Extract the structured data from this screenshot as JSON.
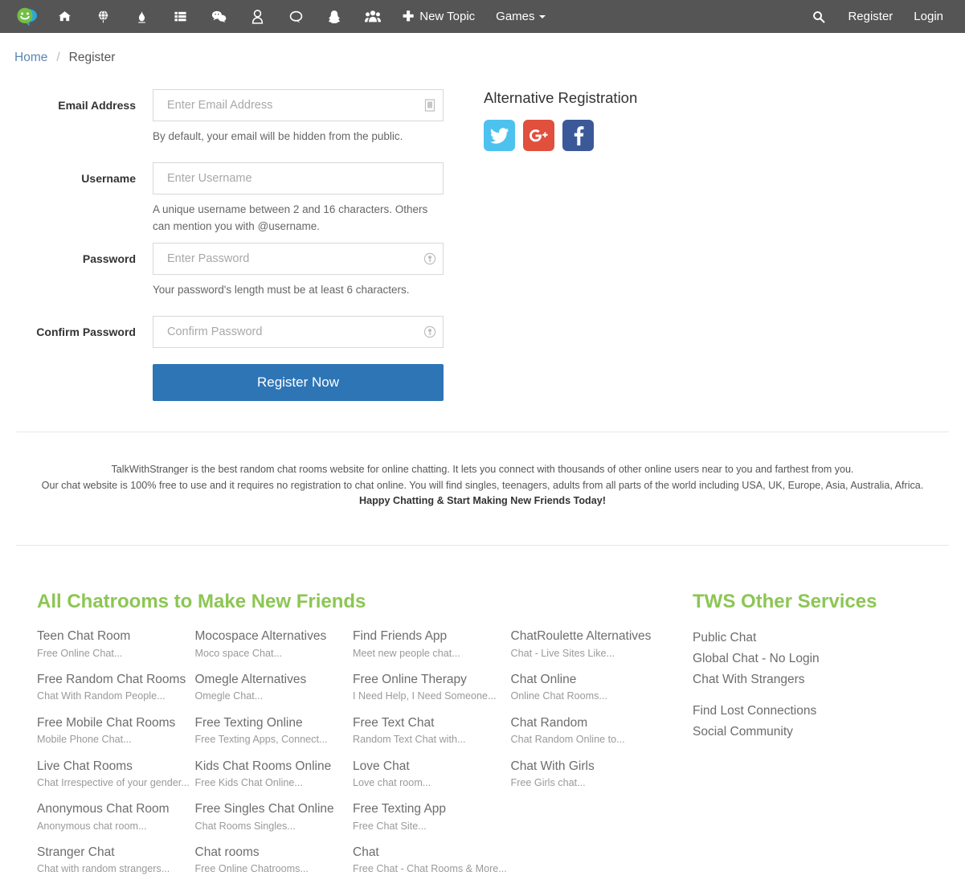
{
  "navbar": {
    "brand": {
      "name": "talkwithstranger-logo",
      "alt": "TalkWithStranger"
    },
    "icons": [
      {
        "name": "home-icon",
        "label": "Home"
      },
      {
        "name": "globe-icon",
        "label": "World"
      },
      {
        "name": "fire-icon",
        "label": "Trending"
      },
      {
        "name": "list-icon",
        "label": "Topics"
      },
      {
        "name": "weixin-chat-icon",
        "label": "Chat"
      },
      {
        "name": "user-icon",
        "label": "Profile"
      },
      {
        "name": "comment-icon",
        "label": "Messages"
      },
      {
        "name": "snapchat-ghost-icon",
        "label": "Snapchat"
      },
      {
        "name": "users-group-icon",
        "label": "Groups"
      }
    ],
    "new_topic_label": "New Topic",
    "new_topic_plus": "✚",
    "games_label": "Games",
    "search_icon": "search-icon",
    "register_label": "Register",
    "login_label": "Login",
    "background_color": "#555555"
  },
  "breadcrumb": {
    "home": "Home",
    "separator": "/",
    "current": "Register"
  },
  "form": {
    "email": {
      "label": "Email Address",
      "placeholder": "Enter Email Address",
      "value": "",
      "help": "By default, your email will be hidden from the public.",
      "icon": "password-manager-icon"
    },
    "username": {
      "label": "Username",
      "placeholder": "Enter Username",
      "value": "",
      "help": "A unique username between 2 and 16 characters. Others can mention you with @username."
    },
    "password": {
      "label": "Password",
      "placeholder": "Enter Password",
      "value": "",
      "help": "Your password's length must be at least 6 characters.",
      "icon": "key-circle-icon"
    },
    "confirm_password": {
      "label": "Confirm Password",
      "placeholder": "Confirm Password",
      "value": "",
      "icon": "key-circle-icon"
    },
    "submit_label": "Register Now",
    "submit_color": "#2e75b6"
  },
  "alt_registration": {
    "title": "Alternative Registration",
    "providers": [
      {
        "name": "twitter-icon",
        "label": "Twitter",
        "color": "#4ec2ef"
      },
      {
        "name": "google-plus-icon",
        "label": "Google Plus",
        "color": "#e0503d"
      },
      {
        "name": "facebook-icon",
        "label": "Facebook",
        "color": "#3b5998"
      }
    ]
  },
  "description": {
    "line1": "TalkWithStranger is the best random chat rooms website for online chatting. It lets you connect with thousands of other online users near to you and farthest from you.",
    "line2": "Our chat website is 100% free to use and it requires no registration to chat online. You will find singles, teenagers, adults from all parts of the world including USA, UK, Europe, Asia, Australia, Africa.",
    "line3": "Happy Chatting & Start Making New Friends Today!"
  },
  "footer": {
    "chatrooms_title": "All Chatrooms to Make New Friends",
    "title_color": "#8cc653",
    "columns": [
      [
        {
          "title": "Teen Chat Room",
          "sub": "Free Online Chat..."
        },
        {
          "title": "Free Random Chat Rooms",
          "sub": "Chat With Random People..."
        },
        {
          "title": "Free Mobile Chat Rooms",
          "sub": "Mobile Phone Chat..."
        },
        {
          "title": "Live Chat Rooms",
          "sub": "Chat Irrespective of your gender..."
        },
        {
          "title": "Anonymous Chat Room",
          "sub": "Anonymous chat room..."
        },
        {
          "title": "Stranger Chat",
          "sub": "Chat with random strangers..."
        }
      ],
      [
        {
          "title": "Mocospace Alternatives",
          "sub": "Moco space Chat..."
        },
        {
          "title": "Omegle Alternatives",
          "sub": "Omegle Chat..."
        },
        {
          "title": "Free Texting Online",
          "sub": "Free Texting Apps, Connect..."
        },
        {
          "title": "Kids Chat Rooms Online",
          "sub": "Free Kids Chat Online..."
        },
        {
          "title": "Free Singles Chat Online",
          "sub": "Chat Rooms Singles..."
        },
        {
          "title": "Chat rooms",
          "sub": "Free Online Chatrooms..."
        }
      ],
      [
        {
          "title": "Find Friends App",
          "sub": "Meet new people chat..."
        },
        {
          "title": "Free Online Therapy",
          "sub": "I Need Help, I Need Someone..."
        },
        {
          "title": "Free Text Chat",
          "sub": "Random Text Chat with..."
        },
        {
          "title": "Love Chat",
          "sub": "Love chat room..."
        },
        {
          "title": "Free Texting App",
          "sub": "Free Chat Site..."
        },
        {
          "title": "Chat",
          "sub": "Free Chat - Chat Rooms & More..."
        }
      ],
      [
        {
          "title": "ChatRoulette Alternatives",
          "sub": "Chat - Live Sites Like..."
        },
        {
          "title": "Chat Online",
          "sub": "Online Chat Rooms..."
        },
        {
          "title": "Chat Random",
          "sub": "Chat Random Online to..."
        },
        {
          "title": "Chat With Girls",
          "sub": "Free Girls chat..."
        }
      ]
    ],
    "services_title": "TWS Other Services",
    "services_group1": [
      "Public Chat",
      "Global Chat - No Login",
      "Chat With Strangers"
    ],
    "services_group2": [
      "Find Lost Connections",
      "Social Community"
    ]
  }
}
